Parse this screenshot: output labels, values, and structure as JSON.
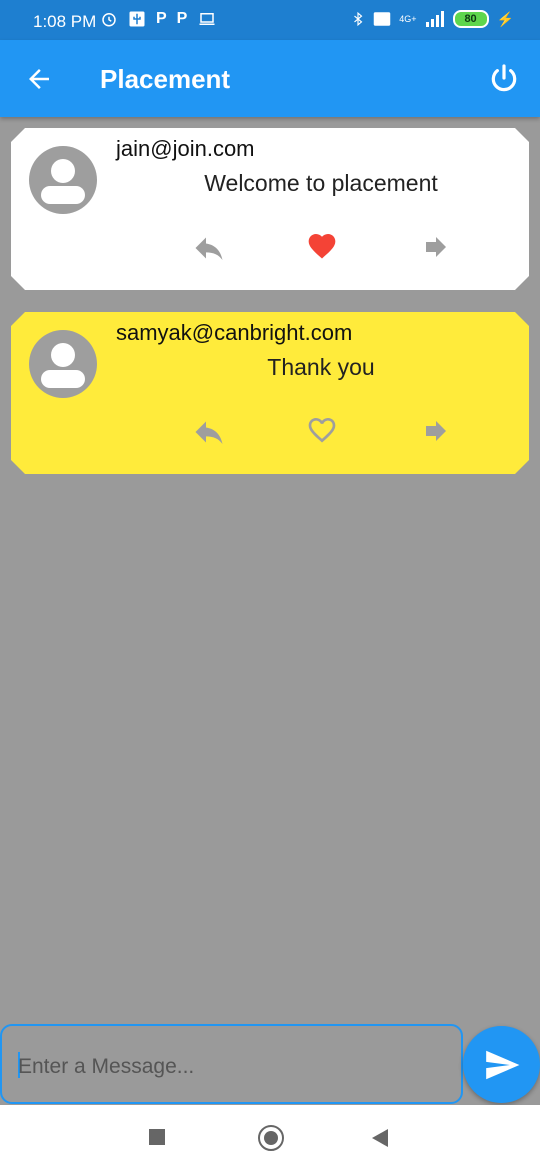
{
  "status_bar": {
    "time": "1:08 PM",
    "left_icons": [
      "alarm-icon",
      "usb-icon",
      "p-icon",
      "p-icon",
      "laptop-icon"
    ],
    "right_icons": [
      "bluetooth-icon",
      "volte-icon",
      "signal-icon"
    ],
    "network_label": "4G+",
    "battery_level": "80"
  },
  "app_bar": {
    "title": "Placement",
    "back_icon": "arrow-back-icon",
    "power_icon": "power-icon"
  },
  "messages": [
    {
      "email": "jain@join.com",
      "text": "Welcome to placement",
      "liked": true,
      "background": "#ffffff"
    },
    {
      "email": "samyak@canbright.com",
      "text": "Thank you",
      "liked": false,
      "background": "#ffeb3b"
    }
  ],
  "composer": {
    "placeholder": "Enter a Message...",
    "value": ""
  },
  "colors": {
    "primary": "#2196f3",
    "heart_liked": "#f44336",
    "icon_gray": "#9e9e9e",
    "page_background": "#9a9a9a"
  }
}
